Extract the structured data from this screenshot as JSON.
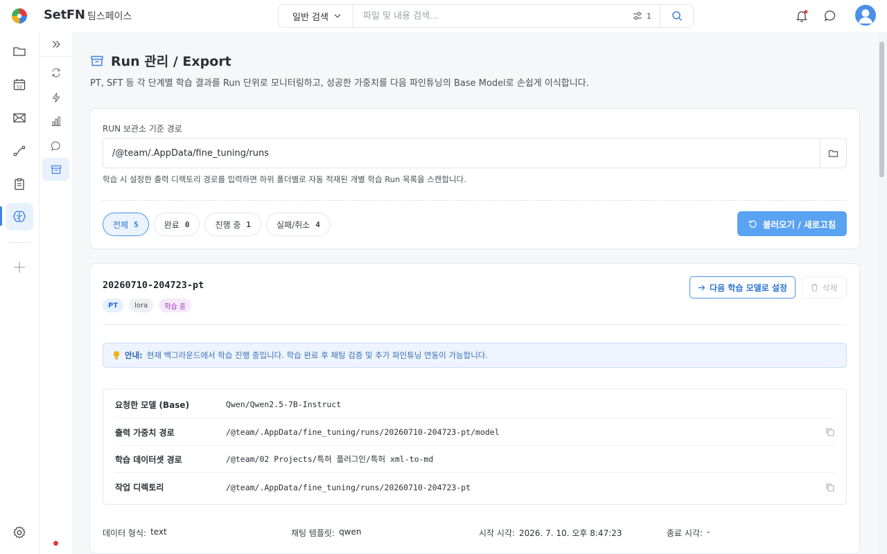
{
  "app": {
    "brand": "SetFN",
    "workspace": "팀스페이스"
  },
  "search": {
    "mode": "일반 검색",
    "placeholder": "파일 및 내용 검색...",
    "filter_count": "1"
  },
  "page": {
    "title": "Run 관리 / Export",
    "description": "PT, SFT 등 각 단계별 학습 결과를 Run 단위로 모니터링하고, 성공한 가중치를 다음 파인튜닝의 Base Model로 손쉽게 이식합니다."
  },
  "storage": {
    "label": "RUN 보관소 기준 경로",
    "path": "/@team/.AppData/fine_tuning/runs",
    "hint": "학습 시 설정한 출력 디렉토리 경로를 입력하면 하위 폴더별로 자동 적재된 개별 학습 Run 목록을 스캔합니다."
  },
  "filters": [
    {
      "label": "전체",
      "count": "5"
    },
    {
      "label": "완료",
      "count": "0"
    },
    {
      "label": "진행 중",
      "count": "1"
    },
    {
      "label": "실패/취소",
      "count": "4"
    }
  ],
  "refresh_label": "불러오기 / 새로고침",
  "run": {
    "name": "20260710-204723-pt",
    "tags": [
      "PT",
      "lora",
      "학습 중"
    ],
    "next_label": "다음 학습 모델로 설정",
    "delete_label": "삭제",
    "notice_title": "안내:",
    "notice_text": "현재 백그라운드에서 학습 진행 중입니다. 학습 완료 후 채팅 검증 및 추가 파인튜닝 연동이 가능합니다.",
    "info": [
      {
        "key": "요청한 모델 (Base)",
        "value": "Qwen/Qwen2.5-7B-Instruct"
      },
      {
        "key": "출력 가중치 경로",
        "value": "/@team/.AppData/fine_tuning/runs/20260710-204723-pt/model"
      },
      {
        "key": "학습 데이터셋 경로",
        "value": "/@team/02 Projects/특허 플러그인/특허 xml-to-md"
      },
      {
        "key": "작업 디렉토리",
        "value": "/@team/.AppData/fine_tuning/runs/20260710-204723-pt"
      }
    ],
    "meta": [
      {
        "key": "데이터 형식:",
        "value": "text"
      },
      {
        "key": "채팅 템플릿:",
        "value": "qwen"
      },
      {
        "key": "시작 시각:",
        "value": "2026. 7. 10. 오후 8:47:23"
      },
      {
        "key": "종료 시각:",
        "value": "-"
      }
    ]
  },
  "colors": {
    "accent": "#4a8fe7",
    "primary_button": "#5aa2f2",
    "notification_dot": "#e5383b",
    "tag_progress": "#a23bbf"
  }
}
